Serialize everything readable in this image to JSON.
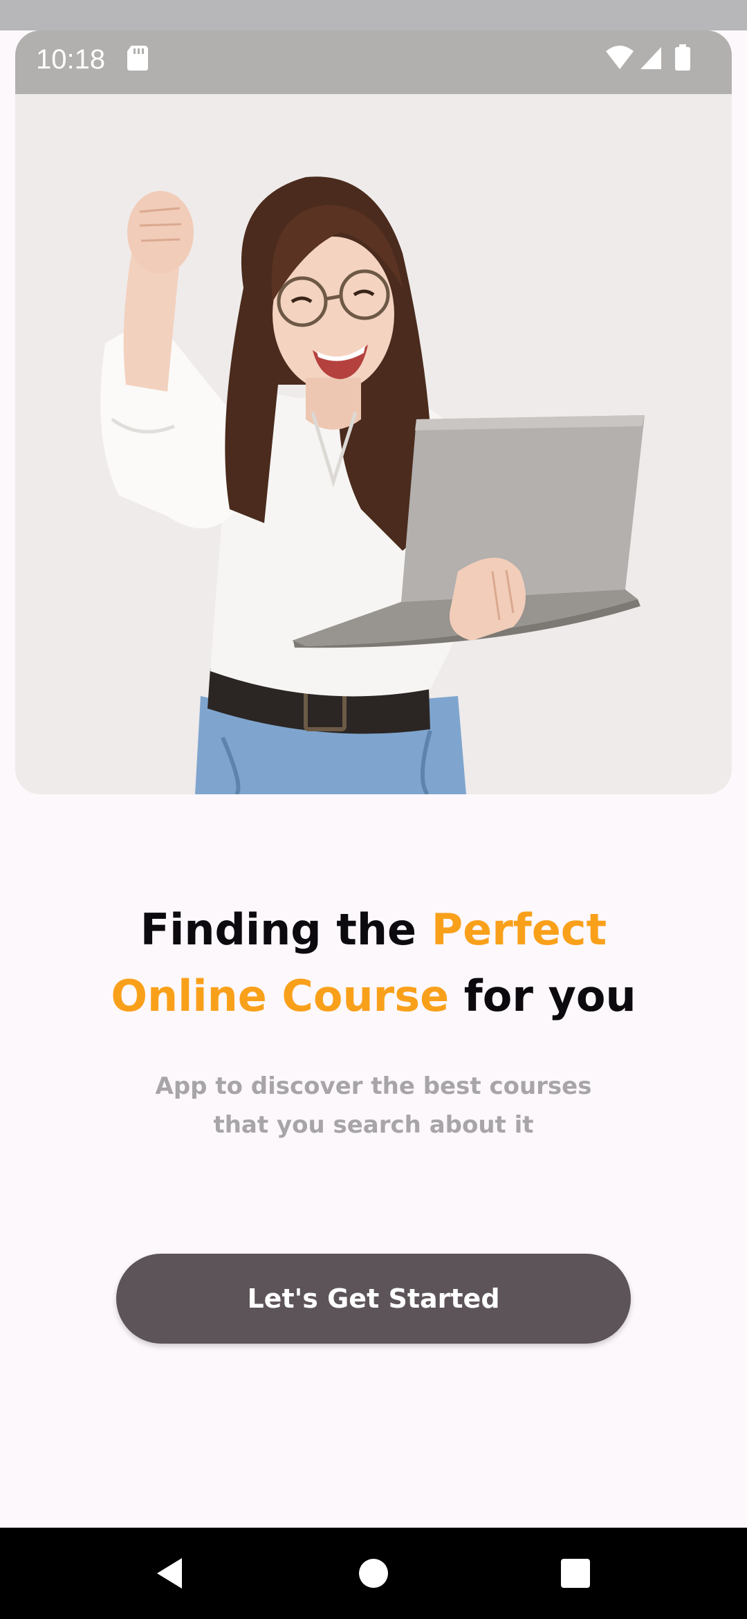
{
  "status_bar": {
    "time": "10:18",
    "icons": [
      "sd-card-icon",
      "wifi-icon",
      "cellular-signal-icon",
      "battery-icon"
    ]
  },
  "hero": {
    "image": "woman-with-laptop-illustration"
  },
  "headline": {
    "part1": "Finding the ",
    "part2_accent": "Perfect",
    "part3_accent": "Online Course",
    "part4": " for you"
  },
  "subtitle": {
    "line1": "App to discover the best courses",
    "line2": "that you search about it"
  },
  "cta": {
    "label": "Let's Get Started"
  },
  "nav": {
    "icons": [
      "back-icon",
      "home-icon",
      "recents-icon"
    ]
  },
  "colors": {
    "accent": "#f9a01b",
    "button": "#5c5459",
    "background": "#fdf8fb",
    "subtitle": "#a7a5a7"
  }
}
